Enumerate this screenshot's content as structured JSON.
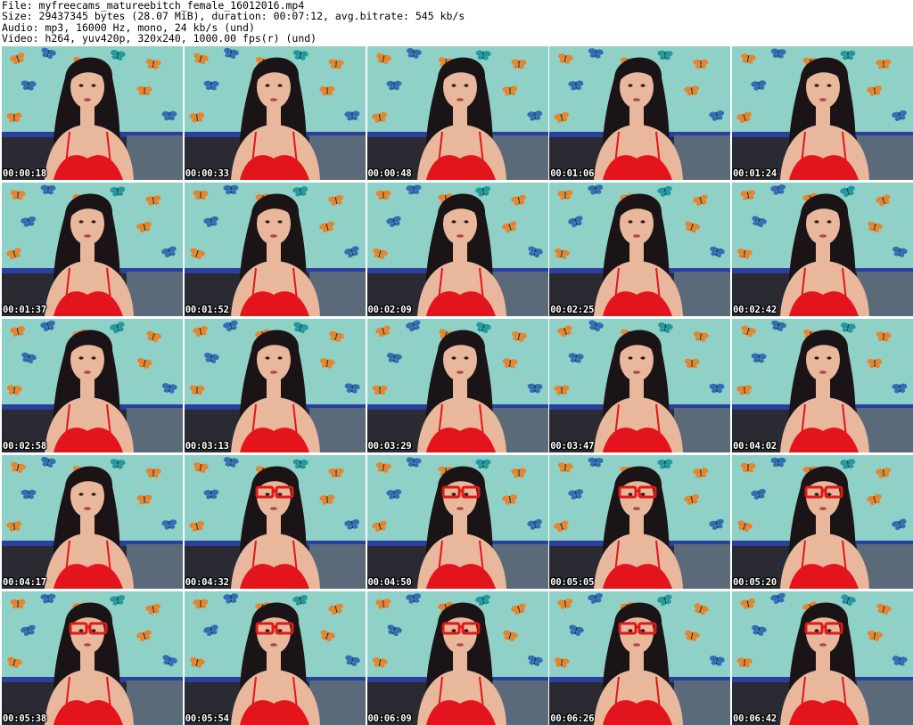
{
  "header": {
    "file_line": "File: myfreecams_matureebitch_female_16012016.mp4",
    "size_line": "Size: 29437345 bytes (28.07 MiB), duration: 00:07:12, avg.bitrate: 545 kb/s",
    "audio_line": "Audio: mp3, 16000 Hz, mono, 24 kb/s (und)",
    "video_line": "Video: h264, yuv420p, 320x240, 1000.00 fps(r) (und)"
  },
  "thumbnails": [
    {
      "time": "00:00:18",
      "glasses": false
    },
    {
      "time": "00:00:33",
      "glasses": false
    },
    {
      "time": "00:00:48",
      "glasses": false
    },
    {
      "time": "00:01:06",
      "glasses": false
    },
    {
      "time": "00:01:24",
      "glasses": false
    },
    {
      "time": "00:01:37",
      "glasses": false
    },
    {
      "time": "00:01:52",
      "glasses": false
    },
    {
      "time": "00:02:09",
      "glasses": false
    },
    {
      "time": "00:02:25",
      "glasses": false
    },
    {
      "time": "00:02:42",
      "glasses": false
    },
    {
      "time": "00:02:58",
      "glasses": false
    },
    {
      "time": "00:03:13",
      "glasses": false
    },
    {
      "time": "00:03:29",
      "glasses": false
    },
    {
      "time": "00:03:47",
      "glasses": false
    },
    {
      "time": "00:04:02",
      "glasses": false
    },
    {
      "time": "00:04:17",
      "glasses": false
    },
    {
      "time": "00:04:32",
      "glasses": true
    },
    {
      "time": "00:04:50",
      "glasses": true
    },
    {
      "time": "00:05:05",
      "glasses": true
    },
    {
      "time": "00:05:20",
      "glasses": true
    },
    {
      "time": "00:05:38",
      "glasses": true
    },
    {
      "time": "00:05:54",
      "glasses": true
    },
    {
      "time": "00:06:09",
      "glasses": true
    },
    {
      "time": "00:06:26",
      "glasses": true
    },
    {
      "time": "00:06:42",
      "glasses": true
    }
  ],
  "colors": {
    "wall": "#8fd0c7",
    "butterfly_orange": "#e8842a",
    "butterfly_blue": "#2f6fb8",
    "butterfly_teal": "#1f9aa0",
    "hair": "#1b1416",
    "skin": "#e8b79c",
    "top": "#e4141c",
    "glasses": "#e01818",
    "sofa_blue": "#2b3f9e"
  }
}
